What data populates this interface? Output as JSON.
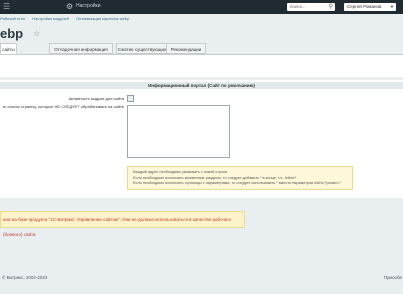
{
  "topbar": {
    "menu_icon": "menu-icon",
    "settings_label": "Настройки",
    "search_placeholder": "поиск...",
    "user_name": "Сергей Романов"
  },
  "breadcrumb": [
    "Рабочий стол",
    "Настройки модулей",
    "Оптимизация картинок webp"
  ],
  "page": {
    "title": "ebp"
  },
  "tabs": [
    {
      "label": "сайты"
    },
    {
      "label": "Отладочная информация"
    },
    {
      "label": "Сжатие существующих картинок"
    },
    {
      "label": "Рекомендации"
    }
  ],
  "section": {
    "header": "Информационный портал (Сайт по умолчанию)",
    "active_label": "Активность модуля для сайта",
    "exclude_label": "ть список страниц, которые НЕ СЛЕДУЕТ обрабатывать на сайте",
    "note_lines": [
      "Каждый адрес необходимо указывать с новой строки.",
      "Если необходимо исключить вложенные разделы, то следует добавить * в конце, т.е. /bitrix/*",
      "Если необходимо исключить страницы с параметрами, то следует использовать * вместо параметров /bitrix/?param=*"
    ]
  },
  "warning": "ана на базе продукта \"1С-Битрикс: Управление сайтом\". Она не должна использоваться в качестве рабочего (боевого) сайта",
  "footer": {
    "copyright": "© Битрикс, 2002-2023",
    "link": "Приообе"
  }
}
